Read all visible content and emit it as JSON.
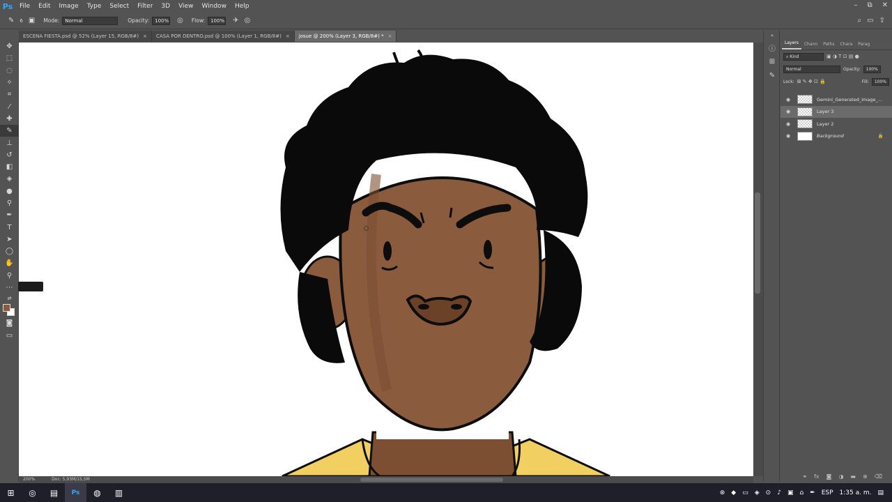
{
  "menubar": {
    "logo": "Ps",
    "items": [
      "File",
      "Edit",
      "Image",
      "Type",
      "Select",
      "Filter",
      "3D",
      "View",
      "Window",
      "Help"
    ],
    "win_controls": [
      "–",
      "⧉",
      "✕"
    ]
  },
  "options": {
    "mode_label": "Mode:",
    "mode_value": "Normal",
    "opacity_label": "Opacity:",
    "opacity_value": "100%",
    "flow_label": "Flow:",
    "flow_value": "100%",
    "brush_size": "6"
  },
  "tabs": [
    {
      "label": "ESCENA FIESTA.psd @ 52% (Layer 15, RGB/8#)",
      "close": "×"
    },
    {
      "label": "CASA POR DENTRO.psd @ 100% (Layer 1, RGB/8#)",
      "close": "×"
    },
    {
      "label": "josue @ 200% (Layer 3, RGB/8#) *",
      "close": "×"
    }
  ],
  "status": {
    "zoom": "200%",
    "doc": "Doc: 5,93M/15,5M"
  },
  "layers_panel": {
    "tabs": [
      "Layers",
      "Chann",
      "Paths",
      "Chara",
      "Parag"
    ],
    "kind_label": "Kind",
    "blend_mode": "Normal",
    "opacity_label": "Opacity:",
    "opacity_value": "100%",
    "lock_label": "Lock:",
    "fill_label": "Fill:",
    "fill_value": "100%",
    "layers": [
      "Gemini_Generated_Image_...",
      "Layer 3",
      "Layer 2",
      "Background"
    ]
  },
  "taskbar": {
    "lang": "ESP",
    "time": "1:35 a. m."
  },
  "colors": {
    "foreground": "#8a5a3a",
    "background": "#ffffff",
    "skin": "#8a5b3c",
    "hair": "#0a0a0a",
    "shirt": "#f2cf61"
  }
}
